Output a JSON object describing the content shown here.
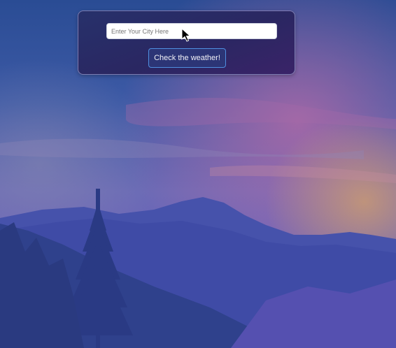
{
  "search": {
    "placeholder": "Enter Your City Here",
    "value": ""
  },
  "actions": {
    "check_label": "Check the weather!"
  },
  "background": {
    "scene": "mountain-landscape",
    "colors": {
      "sky_top": "#2a4f96",
      "sky_mid": "#5f6bb4",
      "cloud_pink": "#b06aa8",
      "glow_orange": "#c99a6a",
      "mountain": "#3f52a8",
      "forest": "#2c3f86"
    }
  },
  "theme": {
    "card_background": "#2a2762",
    "card_border": "#a0a0d2",
    "button_border": "#4f8fe0"
  }
}
